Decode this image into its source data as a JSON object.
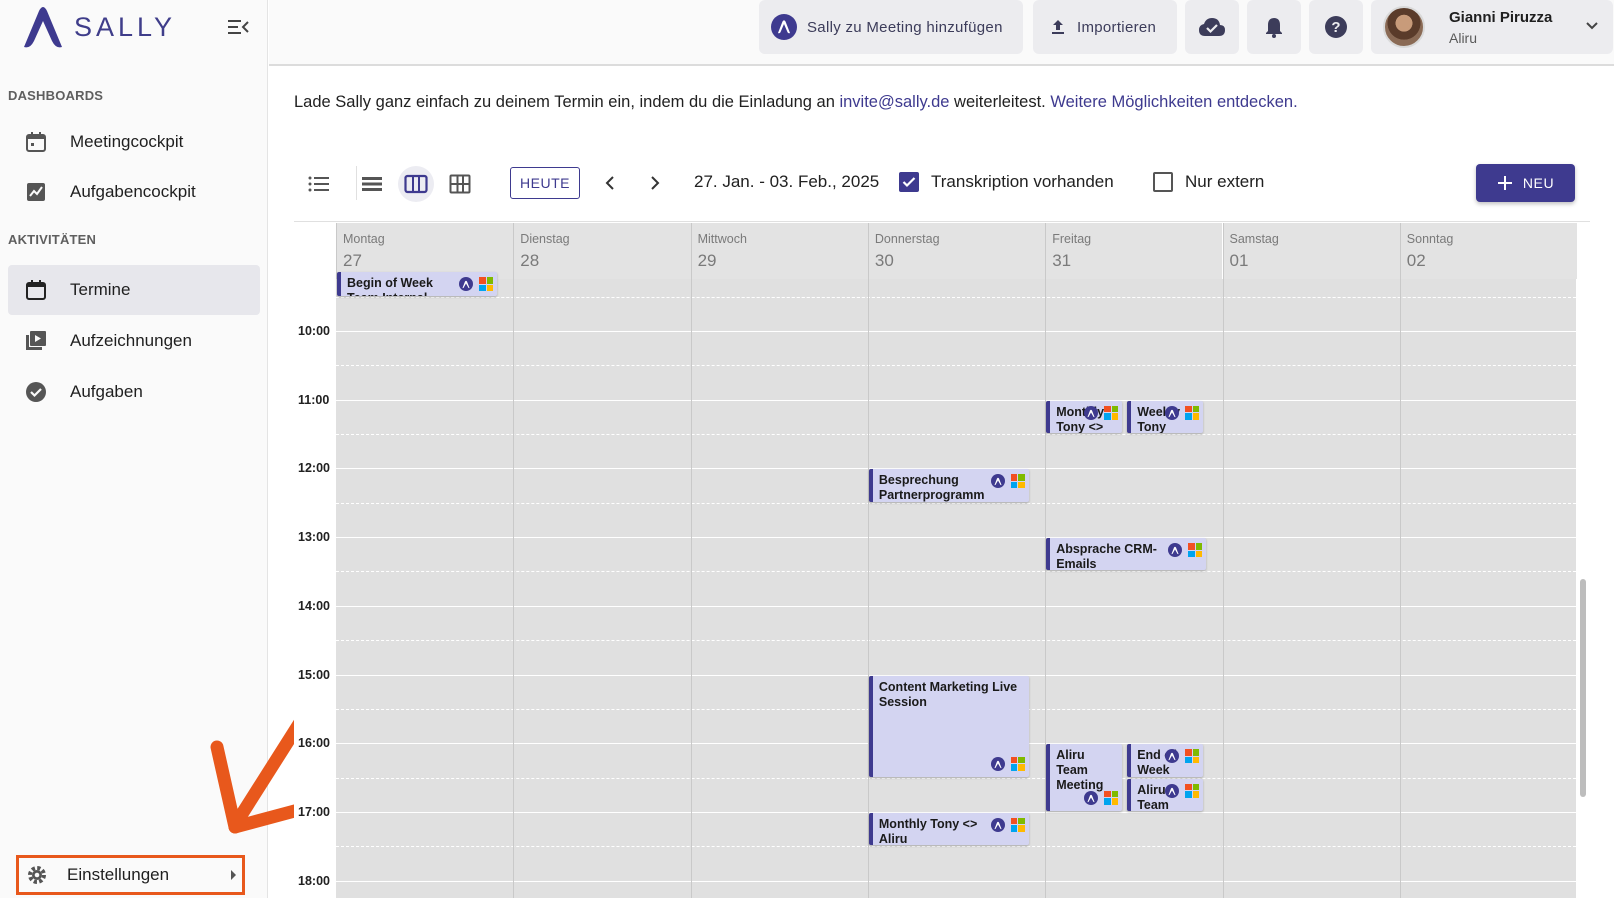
{
  "app": {
    "brand": "SALLY",
    "brand_color": "#3e3a8f",
    "highlight_color": "#e8581c"
  },
  "sidebar": {
    "sections": [
      {
        "title": "DASHBOARDS",
        "items": [
          {
            "label": "Meetingcockpit",
            "icon": "calendar-dashboard-icon"
          },
          {
            "label": "Aufgabencockpit",
            "icon": "chart-icon"
          }
        ]
      },
      {
        "title": "AKTIVITÄTEN",
        "items": [
          {
            "label": "Termine",
            "icon": "calendar-icon",
            "active": true
          },
          {
            "label": "Aufzeichnungen",
            "icon": "video-library-icon"
          },
          {
            "label": "Aufgaben",
            "icon": "check-circle-icon"
          }
        ]
      }
    ],
    "settings": {
      "label": "Einstellungen",
      "icon": "gear-icon"
    }
  },
  "topbar": {
    "add_sally_label": "Sally zu Meeting hinzufügen",
    "import_label": "Importieren",
    "user": {
      "name": "Gianni Piruzza",
      "org": "Aliru"
    }
  },
  "info": {
    "text_before": "Lade Sally ganz einfach zu deinem Termin ein, indem du die Einladung an ",
    "email": "invite@sally.de",
    "text_middle": " weiterleitest. ",
    "more_link": "Weitere Möglichkeiten entdecken."
  },
  "calendar": {
    "today_label": "HEUTE",
    "range_label": "27. Jan. - 03. Feb., 2025",
    "filters": [
      {
        "label": "Transkription vorhanden",
        "checked": true
      },
      {
        "label": "Nur extern",
        "checked": false
      }
    ],
    "new_label": "NEU",
    "days": [
      {
        "name": "Montag",
        "date": "27"
      },
      {
        "name": "Dienstag",
        "date": "28"
      },
      {
        "name": "Mittwoch",
        "date": "29"
      },
      {
        "name": "Donnerstag",
        "date": "30"
      },
      {
        "name": "Freitag",
        "date": "31"
      },
      {
        "name": "Samstag",
        "date": "01"
      },
      {
        "name": "Sonntag",
        "date": "02"
      }
    ],
    "hours": [
      "10:00",
      "11:00",
      "12:00",
      "13:00",
      "14:00",
      "15:00",
      "16:00",
      "17:00",
      "18:00"
    ],
    "events": [
      {
        "title": "Begin of Week",
        "subtitle": "Team Internal",
        "day": 0,
        "start": "09:00",
        "end": "09:30"
      },
      {
        "title": "Monthly",
        "subtitle": "Tony <>",
        "day": 4,
        "start": "11:00",
        "end": "11:30"
      },
      {
        "title": "Weekly",
        "subtitle": "Tony",
        "day": 4,
        "start": "11:00",
        "end": "11:30"
      },
      {
        "title": "Besprechung",
        "subtitle": "Partnerprogramm",
        "day": 3,
        "start": "12:00",
        "end": "12:30"
      },
      {
        "title": "Absprache CRM-",
        "subtitle": "Emails",
        "day": 4,
        "start": "13:00",
        "end": "13:30"
      },
      {
        "title": "Content Marketing Live",
        "subtitle": "Session",
        "day": 3,
        "start": "15:00",
        "end": "16:30"
      },
      {
        "title": "Aliru",
        "subtitle": "Team",
        "extra": "Meeting",
        "day": 4,
        "start": "16:00",
        "end": "17:00"
      },
      {
        "title": "End of",
        "subtitle": "Week",
        "day": 4,
        "start": "16:00",
        "end": "16:30"
      },
      {
        "title": "Aliru",
        "subtitle": "Team",
        "day": 4,
        "start": "16:30",
        "end": "17:00"
      },
      {
        "title": "Monthly Tony <>",
        "subtitle": "Aliru",
        "day": 3,
        "start": "17:00",
        "end": "17:30"
      }
    ]
  }
}
